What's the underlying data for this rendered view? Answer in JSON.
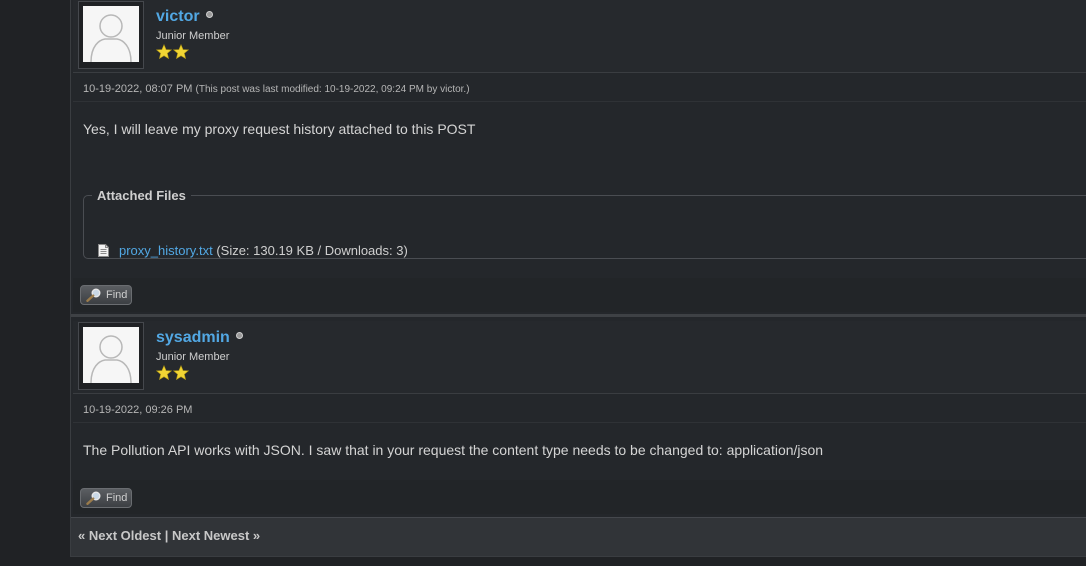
{
  "posts": [
    {
      "username": "victor",
      "status": "offline",
      "user_title": "Junior Member",
      "stars": 2,
      "date": "10-19-2022, 08:07 PM",
      "edit_note": "(This post was last modified: 10-19-2022, 09:24 PM by victor.)",
      "message": "Yes, I will leave my proxy request history attached to this POST",
      "attachments": {
        "legend": "Attached Files",
        "files": [
          {
            "icon": "text-file-icon",
            "name": "proxy_history.txt",
            "info": "(Size: 130.19 KB / Downloads: 3)"
          }
        ]
      },
      "find_label": "Find"
    },
    {
      "username": "sysadmin",
      "status": "offline",
      "user_title": "Junior Member",
      "stars": 2,
      "date": "10-19-2022, 09:26 PM",
      "message": "The Pollution API works with JSON. I saw that in your request the content type needs to be changed to: application/json",
      "find_label": "Find"
    }
  ],
  "navigation": {
    "prev_label": "« Next Oldest",
    "separator": "|",
    "next_label": "Next Newest »"
  },
  "colors": {
    "link": "#52a8e4",
    "background": "#202225",
    "panel": "#24272b",
    "star": "#f1d534"
  }
}
